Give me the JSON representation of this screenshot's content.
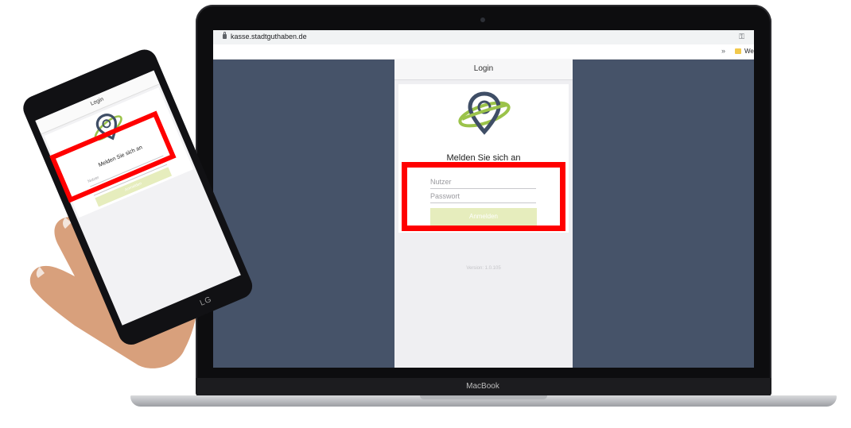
{
  "browser": {
    "url": "kasse.stadtguthaben.de",
    "bookmarks_more": "»",
    "bookmark_folder_label": "Wel"
  },
  "app": {
    "header_title": "Login",
    "heading": "Melden Sie sich an",
    "username_placeholder": "Nutzer",
    "password_placeholder": "Passwort",
    "login_button": "Anmelden",
    "version": "Version: 1.0.105"
  },
  "phone_app": {
    "header_title": "Login",
    "heading": "Melden Sie sich an",
    "username_placeholder": "Nutzer",
    "password_placeholder": "Passwort",
    "login_button": "Anmelden",
    "brand": "LG"
  },
  "laptop": {
    "brand": "MacBook"
  },
  "colors": {
    "screen_background": "#465369",
    "highlight": "#ff0000",
    "button": "#e6edbd",
    "logo_pin": "#3f4e66",
    "logo_orbit": "#9bc34a"
  },
  "icons": [
    "lock-icon",
    "key-icon",
    "folder-icon",
    "logo-pin-icon"
  ]
}
